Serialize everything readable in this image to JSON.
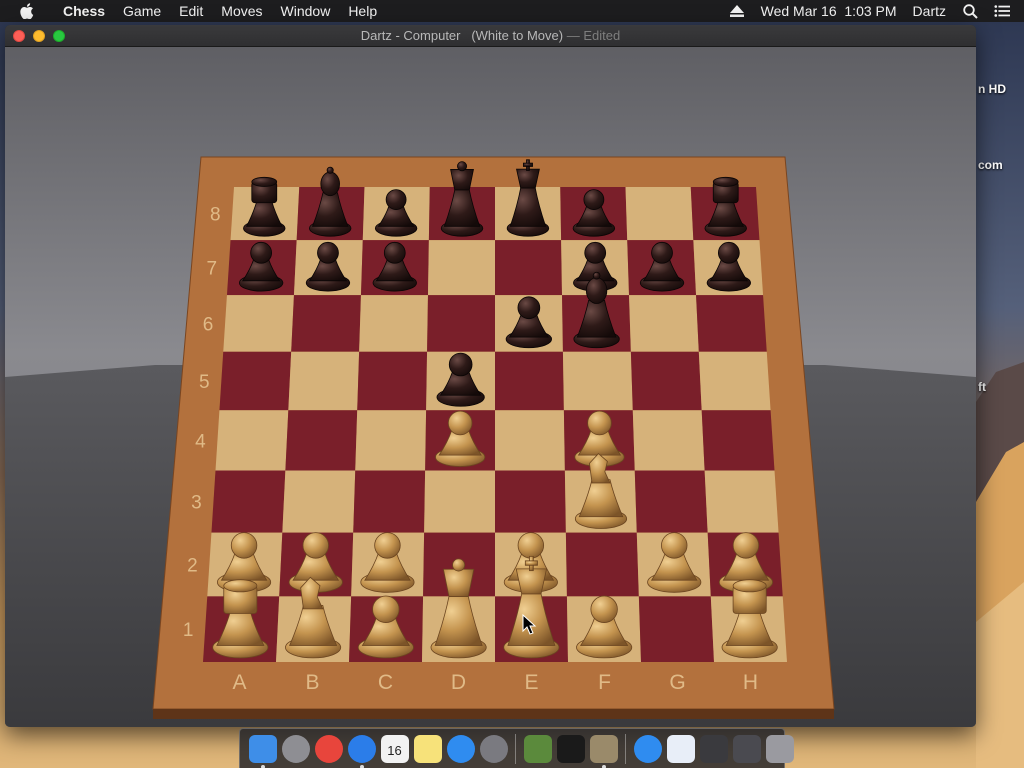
{
  "menubar": {
    "app_name": "Chess",
    "menus": [
      "Game",
      "Edit",
      "Moves",
      "Window",
      "Help"
    ],
    "clock": "Wed Mar 16  1:03 PM",
    "user": "Dartz"
  },
  "window": {
    "title": "Dartz - Computer   (White to Move)",
    "edited": "— Edited"
  },
  "desktop_peek": {
    "labels": [
      "n HD",
      "com",
      "ft"
    ]
  },
  "board": {
    "files": [
      "A",
      "B",
      "C",
      "D",
      "E",
      "F",
      "G",
      "H"
    ],
    "ranks": [
      "1",
      "2",
      "3",
      "4",
      "5",
      "6",
      "7",
      "8"
    ],
    "light_color": "#d6b27a",
    "dark_color": "#7a1f2a",
    "frame_color": "#b5733e",
    "pieces": [
      {
        "color": "black",
        "type": "rook",
        "square": "a8"
      },
      {
        "color": "black",
        "type": "bishop",
        "square": "b8"
      },
      {
        "color": "black",
        "type": "pawn",
        "square": "c8"
      },
      {
        "color": "black",
        "type": "queen",
        "square": "d8"
      },
      {
        "color": "black",
        "type": "king",
        "square": "e8"
      },
      {
        "color": "black",
        "type": "pawn",
        "square": "f8"
      },
      {
        "color": "black",
        "type": "rook",
        "square": "h8"
      },
      {
        "color": "black",
        "type": "pawn",
        "square": "a7"
      },
      {
        "color": "black",
        "type": "pawn",
        "square": "b7"
      },
      {
        "color": "black",
        "type": "pawn",
        "square": "c7"
      },
      {
        "color": "black",
        "type": "pawn",
        "square": "f7"
      },
      {
        "color": "black",
        "type": "pawn",
        "square": "g7"
      },
      {
        "color": "black",
        "type": "pawn",
        "square": "h7"
      },
      {
        "color": "black",
        "type": "pawn",
        "square": "e6"
      },
      {
        "color": "black",
        "type": "bishop",
        "square": "f6"
      },
      {
        "color": "black",
        "type": "pawn",
        "square": "d5"
      },
      {
        "color": "white",
        "type": "pawn",
        "square": "d4"
      },
      {
        "color": "white",
        "type": "pawn",
        "square": "f4"
      },
      {
        "color": "white",
        "type": "knight",
        "square": "f3"
      },
      {
        "color": "white",
        "type": "pawn",
        "square": "a2"
      },
      {
        "color": "white",
        "type": "pawn",
        "square": "b2"
      },
      {
        "color": "white",
        "type": "pawn",
        "square": "c2"
      },
      {
        "color": "white",
        "type": "pawn",
        "square": "e2"
      },
      {
        "color": "white",
        "type": "pawn",
        "square": "g2"
      },
      {
        "color": "white",
        "type": "pawn",
        "square": "h2"
      },
      {
        "color": "white",
        "type": "rook",
        "square": "a1"
      },
      {
        "color": "white",
        "type": "knight",
        "square": "b1"
      },
      {
        "color": "white",
        "type": "pawn",
        "square": "c1"
      },
      {
        "color": "white",
        "type": "queen",
        "square": "d1"
      },
      {
        "color": "white",
        "type": "king",
        "square": "e1"
      },
      {
        "color": "white",
        "type": "pawn",
        "square": "f1"
      },
      {
        "color": "white",
        "type": "rook",
        "square": "h1"
      }
    ]
  },
  "dock": {
    "apps": [
      {
        "name": "finder-icon",
        "color": "#3e8ee8",
        "running": true
      },
      {
        "name": "launchpad-icon",
        "color": "#8e8e93",
        "running": false
      },
      {
        "name": "chrome-icon",
        "color": "#e8453c",
        "running": false
      },
      {
        "name": "safari-icon",
        "color": "#2b7de9",
        "running": true
      },
      {
        "name": "calendar-icon",
        "color": "#f2f2f2",
        "running": false,
        "label": "16"
      },
      {
        "name": "notes-icon",
        "color": "#f7e27a",
        "running": false
      },
      {
        "name": "app-store-icon",
        "color": "#2f8cf0",
        "running": false
      },
      {
        "name": "system-preferences-icon",
        "color": "#7a7a80",
        "running": false
      },
      {
        "name": "minecraft-icon",
        "color": "#5b8a3c",
        "running": false
      },
      {
        "name": "terminal-icon",
        "color": "#1a1a1a",
        "running": false
      },
      {
        "name": "chess-icon",
        "color": "#9a8a6a",
        "running": true
      },
      {
        "name": "app-store-folder-icon",
        "color": "#2f8cf0",
        "running": false
      },
      {
        "name": "document-icon",
        "color": "#e8eef8",
        "running": false
      },
      {
        "name": "screenshot-folder-icon",
        "color": "#3a3a3e",
        "running": false
      },
      {
        "name": "window-folder-icon",
        "color": "#4a4a50",
        "running": false
      },
      {
        "name": "trash-icon",
        "color": "#9a9aa0",
        "running": false
      }
    ]
  }
}
